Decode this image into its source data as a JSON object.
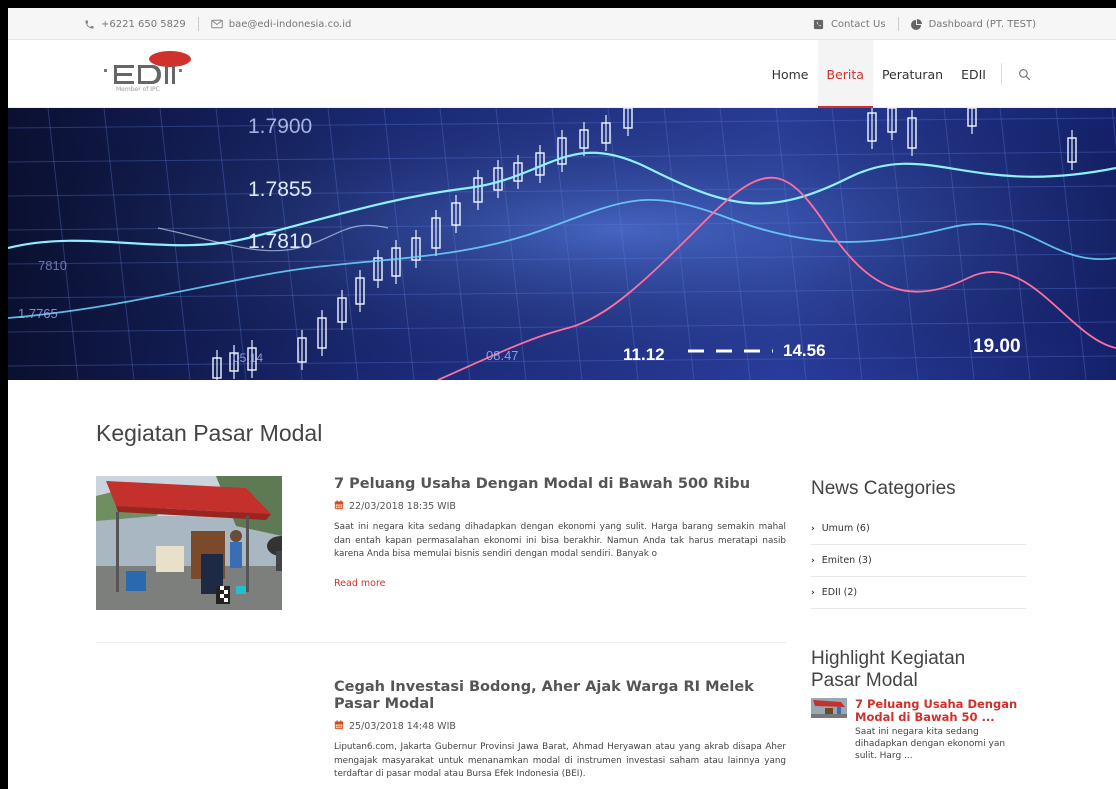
{
  "topbar": {
    "phone": "+6221 650 5829",
    "email": "bae@edi-indonesia.co.id",
    "contact": "Contact Us",
    "dashboard": "Dashboard (PT. TEST)"
  },
  "logo": {
    "text": "EDII",
    "subtitle": "Member of IPC"
  },
  "nav": {
    "home": "Home",
    "berita": "Berita",
    "peraturan": "Peraturan",
    "edii": "EDII",
    "active": "Berita"
  },
  "hero": {
    "labels": [
      "1.7900",
      "1.7855",
      "1.7810",
      "1.7765",
      "7810",
      "05.14",
      "08.47",
      "11.12",
      "14.56",
      "19.00"
    ]
  },
  "page": {
    "title": "Kegiatan Pasar Modal"
  },
  "articles": [
    {
      "title": "7 Peluang Usaha Dengan Modal di Bawah 500 Ribu",
      "date": "22/03/2018 18:35 WIB",
      "excerpt": "Saat ini negara kita sedang dihadapkan dengan ekonomi yang sulit. Harga barang semakin mahal dan entah kapan permasalahan ekonomi ini bisa berakhir. Namun Anda tak harus meratapi nasib karena Anda bisa memulai bisnis sendiri dengan modal sendiri. Banyak o",
      "read_more": "Read more"
    },
    {
      "title": "Cegah Investasi Bodong, Aher Ajak Warga RI Melek Pasar Modal",
      "date": "25/03/2018 14:48 WIB",
      "excerpt": "Liputan6.com, Jakarta Gubernur Provinsi Jawa Barat, Ahmad Heryawan atau yang akrab disapa Aher mengajak masyarakat untuk menanamkan modal di instrumen investasi saham atau lainnya yang terdaftar di pasar modal atau Bursa Efek Indonesia (BEI)."
    }
  ],
  "sidebar": {
    "categories_title": "News Categories",
    "categories": [
      "Umum (6)",
      "Emiten (3)",
      "EDII (2)"
    ],
    "highlight_title": "Highlight Kegiatan Pasar Modal",
    "highlight": {
      "title": "7 Peluang Usaha Dengan Modal di Bawah 50 ...",
      "text": "Saat ini negara kita sedang dihadapkan dengan ekonomi yan sulit. Harg ..."
    }
  },
  "colors": {
    "accent": "#d0312d",
    "hero_bg": "#0d1a55"
  }
}
